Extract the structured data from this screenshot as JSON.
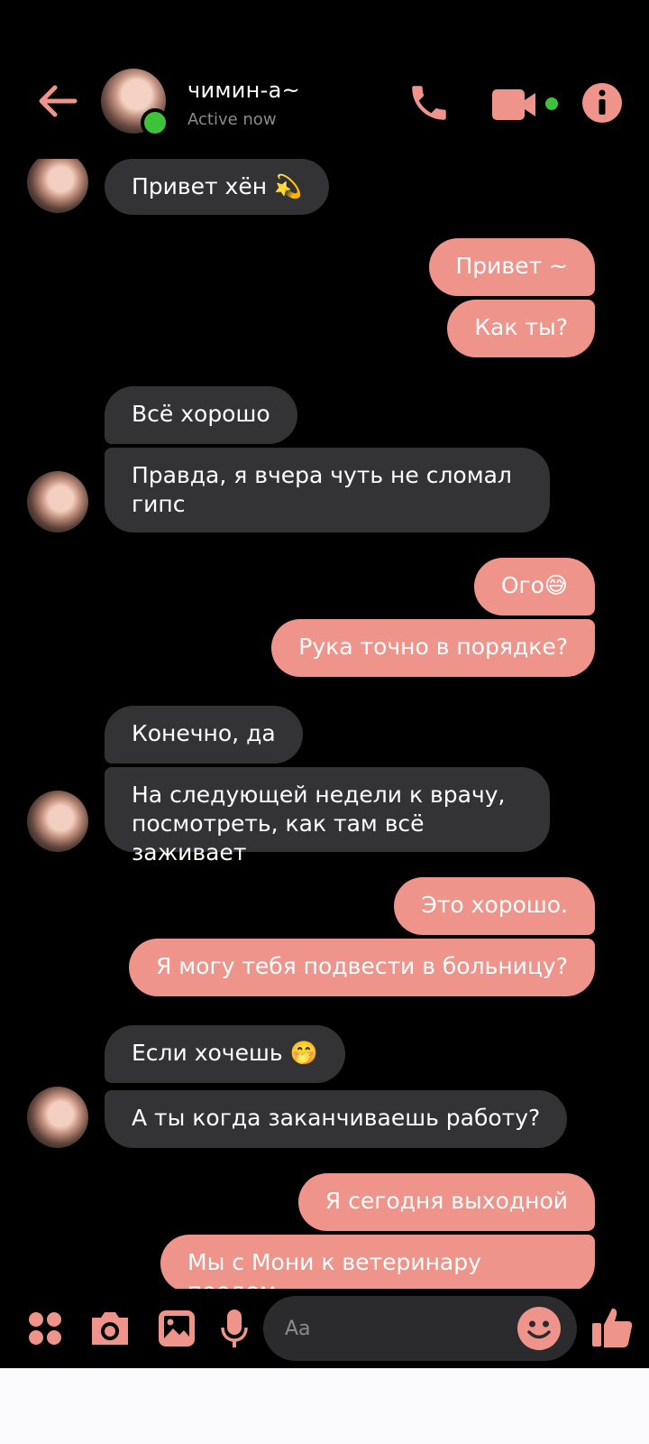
{
  "theme": {
    "accent": "#ee948b",
    "incoming_bubble": "#333336",
    "background": "#000000",
    "online": "#3ec23a"
  },
  "header": {
    "contact_name": "чимин-а~",
    "status": "Active now",
    "icons": [
      "back-arrow-icon",
      "phone-icon",
      "video-camera-icon",
      "info-icon"
    ]
  },
  "messages": [
    {
      "from": "them",
      "text": "Привет хён 💫"
    },
    {
      "from": "me",
      "text": "Привет ~"
    },
    {
      "from": "me",
      "text": "Как ты?"
    },
    {
      "from": "them",
      "text": "Всё хорошо"
    },
    {
      "from": "them",
      "text": "Правда, я вчера чуть не сломал гипс"
    },
    {
      "from": "me",
      "text": "Ого😅"
    },
    {
      "from": "me",
      "text": "Рука точно в порядке?"
    },
    {
      "from": "them",
      "text": "Конечно, да"
    },
    {
      "from": "them",
      "text": "На следующей недели к врачу, посмотреть, как там всё заживает"
    },
    {
      "from": "me",
      "text": "Это хорошо."
    },
    {
      "from": "me",
      "text": "Я могу тебя подвести в больницу?"
    },
    {
      "from": "them",
      "text": "Если хочешь 🤭"
    },
    {
      "from": "them",
      "text": "А ты когда заканчиваешь работу?"
    },
    {
      "from": "me",
      "text": "Я сегодня выходной"
    },
    {
      "from": "me",
      "text": "Мы с Мони к ветеринару поедем"
    }
  ],
  "composer": {
    "placeholder": "Aa",
    "icons": [
      "apps-icon",
      "camera-icon",
      "gallery-icon",
      "microphone-icon",
      "emoji-icon",
      "thumbs-up-icon"
    ]
  }
}
